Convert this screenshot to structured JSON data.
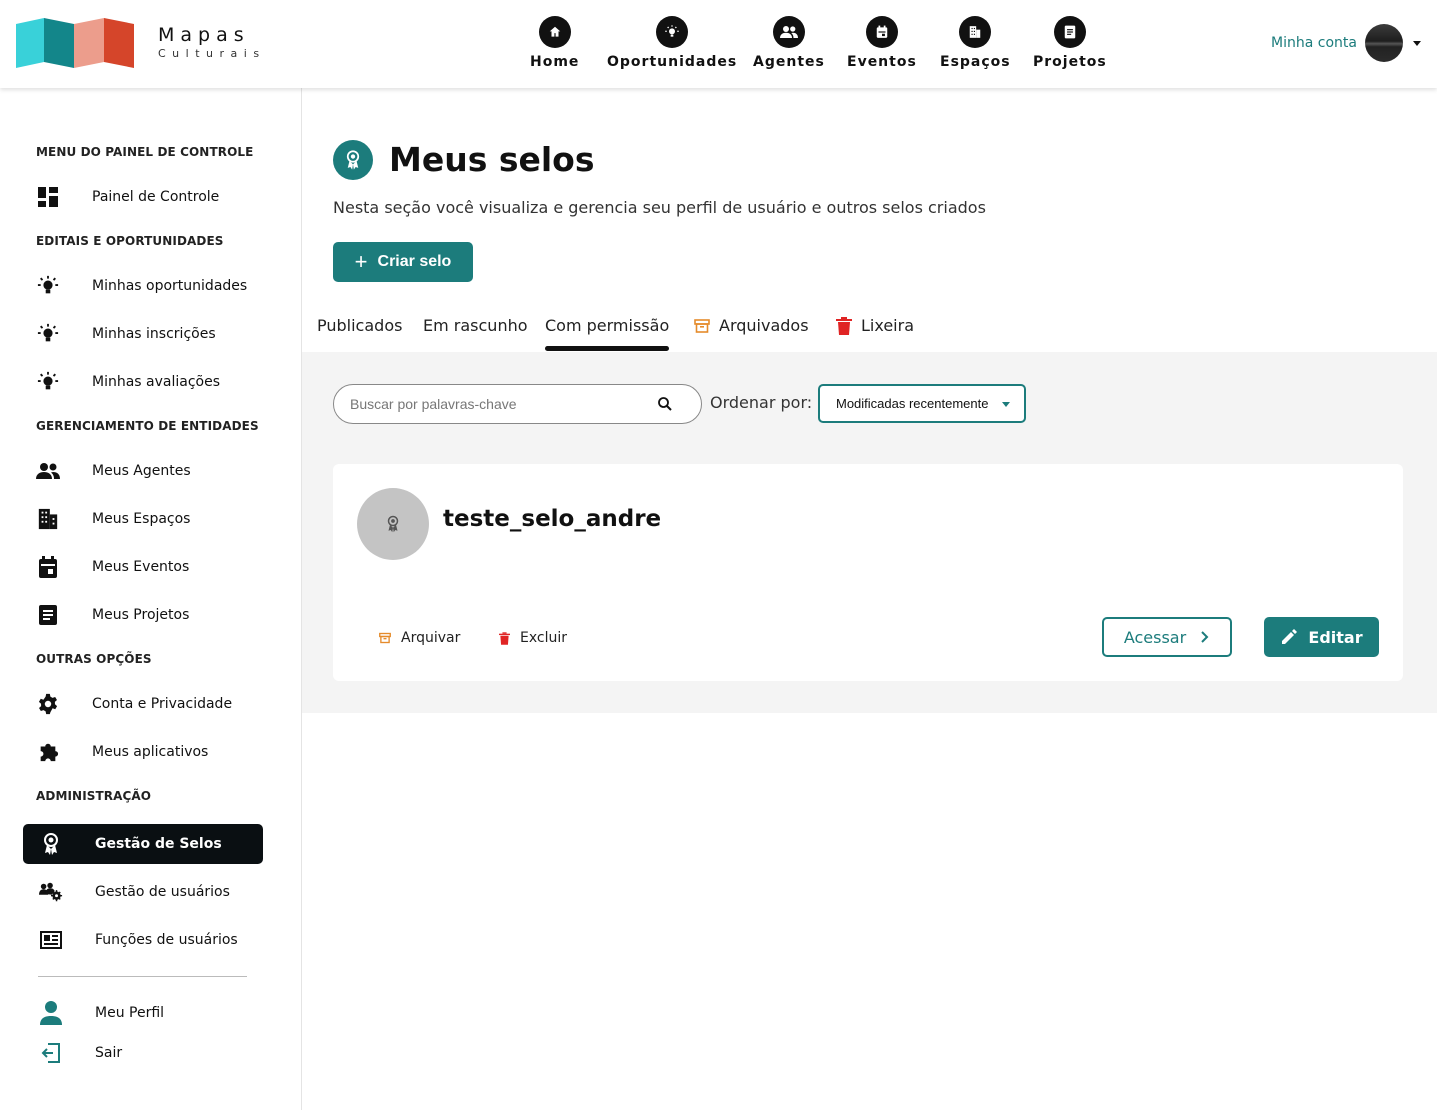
{
  "brand": {
    "line1": "Mapas",
    "line2": "Culturais"
  },
  "nav": [
    {
      "label": "Home",
      "icon": "home-icon"
    },
    {
      "label": "Oportunidades",
      "icon": "lightbulb-icon"
    },
    {
      "label": "Agentes",
      "icon": "people-icon"
    },
    {
      "label": "Eventos",
      "icon": "calendar-icon"
    },
    {
      "label": "Espaços",
      "icon": "building-icon"
    },
    {
      "label": "Projetos",
      "icon": "document-icon"
    }
  ],
  "account": {
    "label": "Minha conta"
  },
  "sidebar": {
    "sections": [
      "MENU DO PAINEL DE CONTROLE",
      "EDITAIS E OPORTUNIDADES",
      "GERENCIAMENTO DE ENTIDADES",
      "OUTRAS OPÇÕES",
      "ADMINISTRAÇÃO"
    ],
    "items": [
      {
        "label": "Painel de Controle",
        "icon": "dashboard-icon"
      },
      {
        "label": "Minhas oportunidades",
        "icon": "lightbulb-icon"
      },
      {
        "label": "Minhas inscrições",
        "icon": "lightbulb-icon"
      },
      {
        "label": "Minhas avaliações",
        "icon": "lightbulb-icon"
      },
      {
        "label": "Meus Agentes",
        "icon": "people-icon"
      },
      {
        "label": "Meus Espaços",
        "icon": "building-icon"
      },
      {
        "label": "Meus Eventos",
        "icon": "calendar-icon"
      },
      {
        "label": "Meus Projetos",
        "icon": "document-icon"
      },
      {
        "label": "Conta e Privacidade",
        "icon": "gear-icon"
      },
      {
        "label": "Meus aplicativos",
        "icon": "puzzle-icon"
      },
      {
        "label": "Gestão de Selos",
        "icon": "seal-icon"
      },
      {
        "label": "Gestão de usuários",
        "icon": "users-gear-icon"
      },
      {
        "label": "Funções de usuários",
        "icon": "id-card-icon"
      },
      {
        "label": "Meu Perfil",
        "icon": "person-icon"
      },
      {
        "label": "Sair",
        "icon": "logout-icon"
      }
    ]
  },
  "main": {
    "title": "Meus selos",
    "description": "Nesta seção você visualiza e gerencia seu perfil de usuário e outros selos criados",
    "create_button": "Criar selo",
    "tabs": [
      {
        "label": "Publicados"
      },
      {
        "label": "Em rascunho"
      },
      {
        "label": "Com permissão",
        "active": true
      },
      {
        "label": "Arquivados",
        "icon": "archive-icon"
      },
      {
        "label": "Lixeira",
        "icon": "trash-icon"
      }
    ],
    "search": {
      "placeholder": "Buscar por palavras-chave",
      "value": ""
    },
    "order": {
      "label": "Ordenar por:",
      "selected": "Modificadas recentemente"
    },
    "cards": [
      {
        "title": "teste_selo_andre",
        "archive_label": "Arquivar",
        "delete_label": "Excluir",
        "access_label": "Acessar",
        "edit_label": "Editar"
      }
    ]
  },
  "colors": {
    "primary": "#1c7c7c",
    "active_bg": "#0a0f12",
    "archive": "#e58b2b",
    "trash": "#e02424"
  }
}
